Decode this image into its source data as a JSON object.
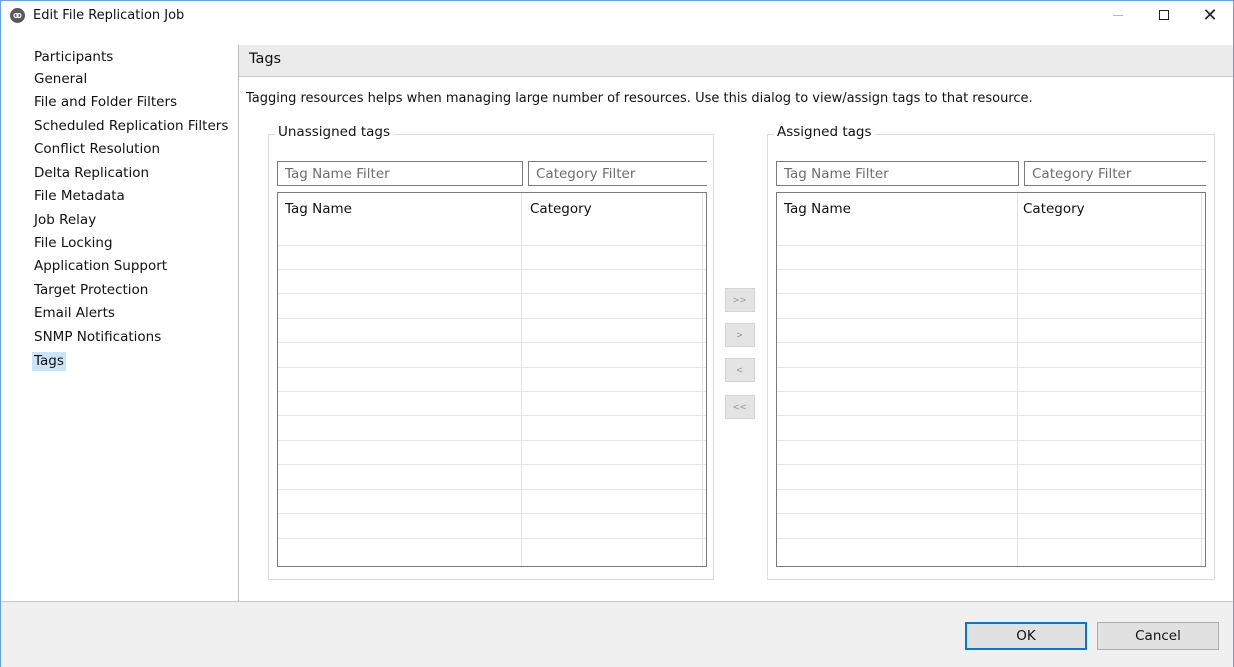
{
  "window": {
    "title": "Edit File Replication Job",
    "controls": {
      "minimize": "minimize-icon",
      "maximize": "maximize-icon",
      "close": "close-icon"
    }
  },
  "sidebar": {
    "items": [
      {
        "label": "Participants",
        "selected": false
      },
      {
        "label": "General",
        "selected": false
      },
      {
        "label": "File and Folder Filters",
        "selected": false
      },
      {
        "label": "Scheduled Replication Filters",
        "selected": false
      },
      {
        "label": "Conflict Resolution",
        "selected": false
      },
      {
        "label": "Delta Replication",
        "selected": false
      },
      {
        "label": "File Metadata",
        "selected": false
      },
      {
        "label": "Job Relay",
        "selected": false
      },
      {
        "label": "File Locking",
        "selected": false
      },
      {
        "label": "Application Support",
        "selected": false
      },
      {
        "label": "Target Protection",
        "selected": false
      },
      {
        "label": "Email Alerts",
        "selected": false
      },
      {
        "label": "SNMP Notifications",
        "selected": false
      },
      {
        "label": "Tags",
        "selected": true
      }
    ]
  },
  "main": {
    "section_title": "Tags",
    "description": "Tagging resources helps when managing large number of resources. Use this dialog to view/assign tags to that resource.",
    "unassigned": {
      "label": "Unassigned tags",
      "tag_filter_placeholder": "Tag Name Filter",
      "category_filter_placeholder": "Category Filter",
      "columns": [
        "Tag Name",
        "Category"
      ],
      "rows": []
    },
    "assigned": {
      "label": "Assigned tags",
      "tag_filter_placeholder": "Tag Name Filter",
      "category_filter_placeholder": "Category Filter",
      "columns": [
        "Tag Name",
        "Category"
      ],
      "rows": []
    },
    "move_buttons": {
      "add_all": ">>",
      "add": ">",
      "remove": "<",
      "remove_all": "<<"
    }
  },
  "footer": {
    "ok_label": "OK",
    "cancel_label": "Cancel"
  },
  "colors": {
    "selection": "#cce4f7",
    "default_button_border": "#0078d7",
    "header_bg": "#ebebeb",
    "footer_bg": "#f0f0f0"
  }
}
